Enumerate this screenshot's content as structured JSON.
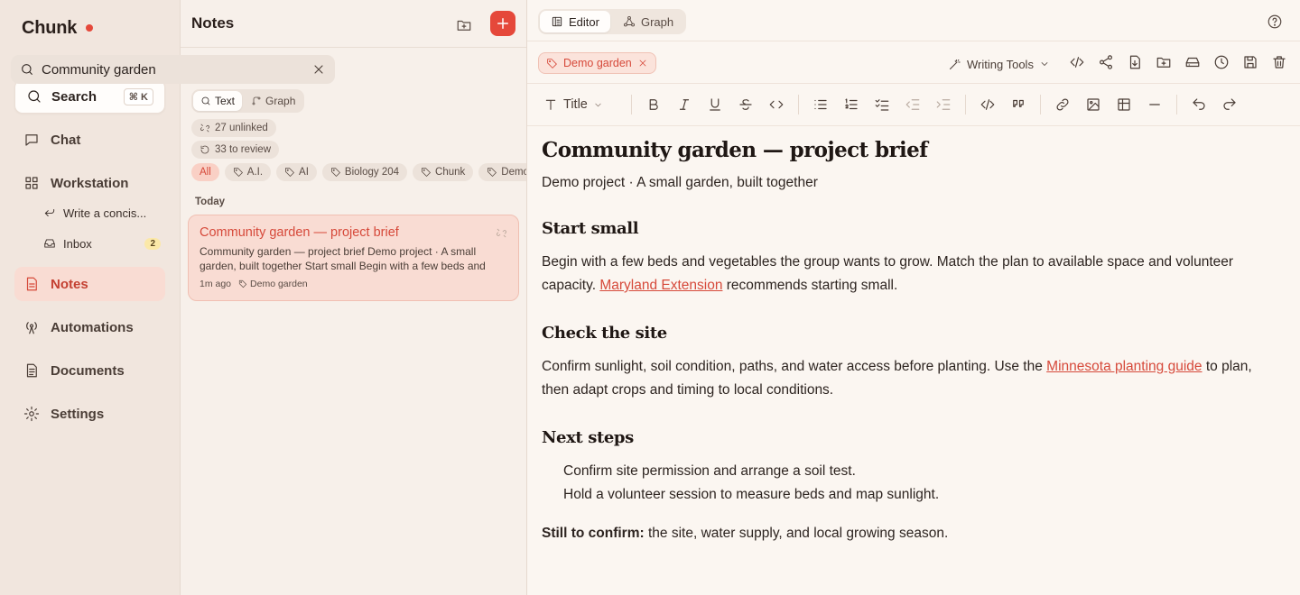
{
  "brand": {
    "name": "Chunk"
  },
  "sidebar": {
    "search_label": "Search",
    "search_shortcut": "⌘ K",
    "items": [
      {
        "label": "Chat",
        "icon": "chat-icon"
      },
      {
        "label": "Workstation",
        "icon": "grid-icon"
      },
      {
        "label": "Notes",
        "icon": "notes-icon",
        "active": true
      },
      {
        "label": "Automations",
        "icon": "broadcast-icon"
      },
      {
        "label": "Documents",
        "icon": "document-icon"
      },
      {
        "label": "Settings",
        "icon": "gear-icon"
      }
    ],
    "sub_items": [
      {
        "label": "Write a concis...",
        "icon": "reply-icon"
      },
      {
        "label": "Inbox",
        "icon": "inbox-icon",
        "badge": "2"
      }
    ]
  },
  "notes_panel": {
    "title": "Notes",
    "search_value": "Community garden",
    "modes": [
      "Text",
      "Graph"
    ],
    "stats": [
      "27 unlinked",
      "33 to review"
    ],
    "tags": [
      "All",
      "A.I.",
      "AI",
      "Biology 204",
      "Chunk",
      "Demo garden"
    ],
    "group_label": "Today",
    "card": {
      "title": "Community garden — project brief",
      "snippet": "Community garden — project brief Demo project · A small garden, built together Start small Begin with a few beds and",
      "time": "1m ago",
      "tag": "Demo garden"
    }
  },
  "editor": {
    "modes": [
      "Editor",
      "Graph"
    ],
    "doc_tag": "Demo garden",
    "writing_tools": "Writing Tools",
    "block_type": "Title",
    "doc": {
      "title": "Community garden — project brief",
      "subtitle": "Demo project · A small garden, built together",
      "s1_heading": "Start small",
      "s1_text_a": "Begin with a few beds and vegetables the group wants to grow. Match the plan to available space and volunteer capacity. ",
      "s1_link": "Maryland Extension",
      "s1_text_b": " recommends starting small.",
      "s2_heading": "Check the site",
      "s2_text_a": "Confirm sunlight, soil condition, paths, and water access before planting. Use the ",
      "s2_link": "Minnesota planting guide",
      "s2_text_b": " to plan, then adapt crops and timing to local conditions.",
      "s3_heading": "Next steps",
      "s3_items": [
        "Confirm site permission and arrange a soil test.",
        "Hold a volunteer session to measure beds and map sunlight."
      ],
      "final_bold": "Still to confirm:",
      "final_text": " the site, water supply, and local growing season."
    }
  },
  "colors": {
    "accent": "#e5483a",
    "sidebar_bg": "#f1e6de",
    "active_bg": "#f9dcd3"
  }
}
